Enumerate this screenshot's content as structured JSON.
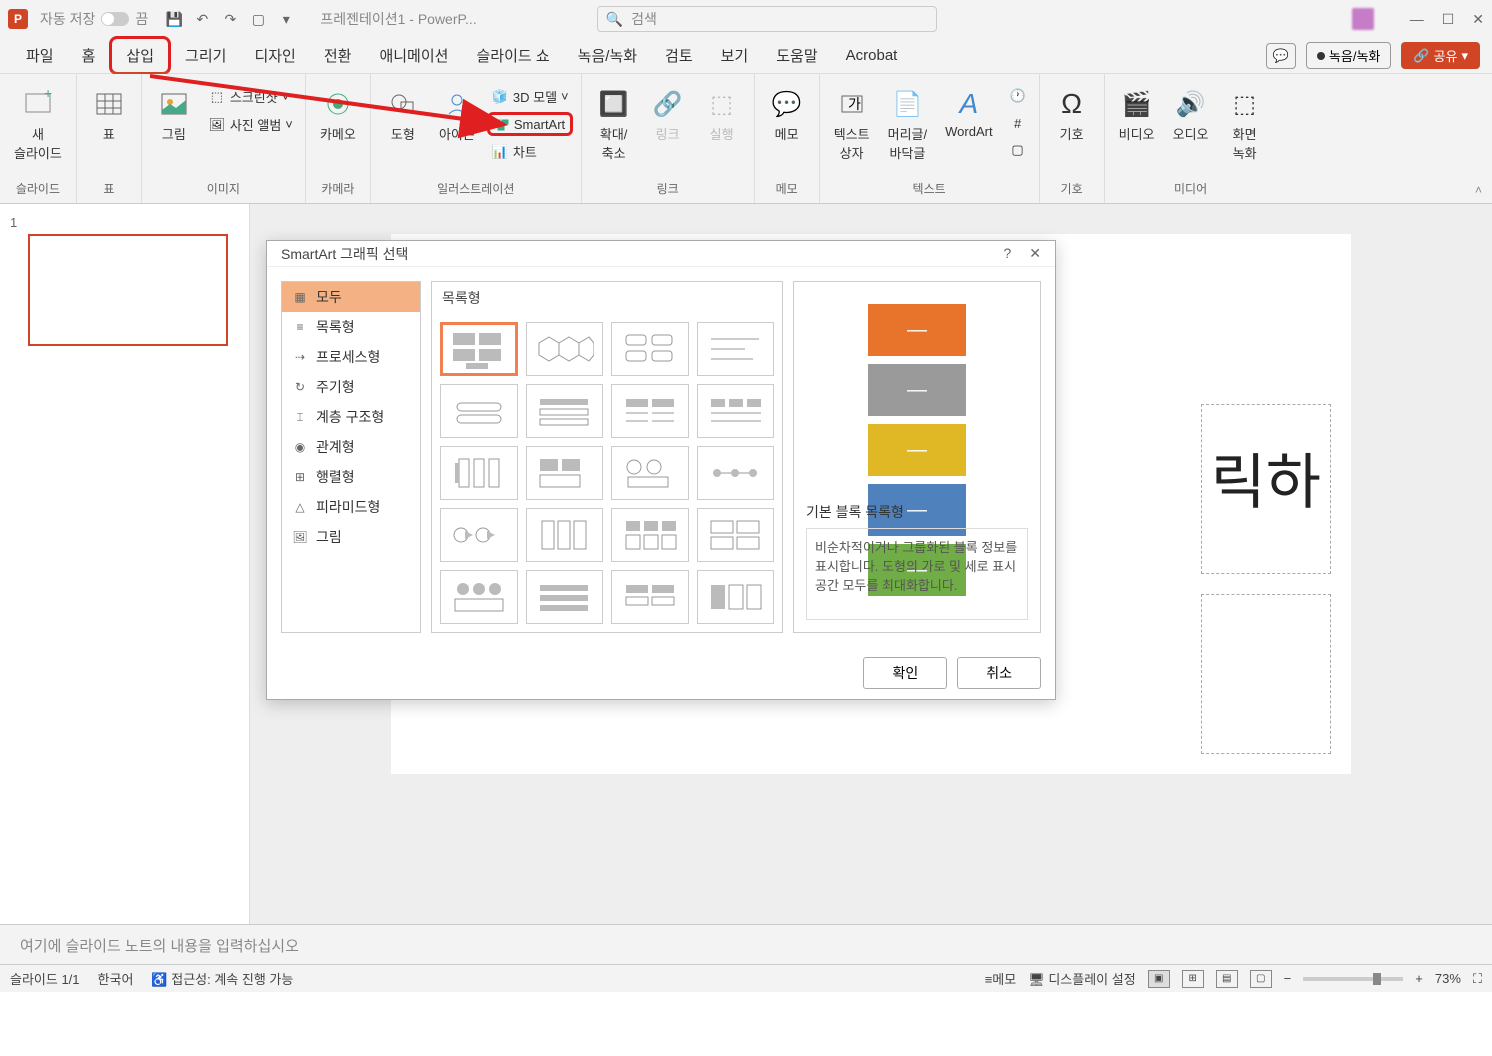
{
  "app": {
    "letter": "P",
    "autosave_label": "자동 저장",
    "autosave_state": "끔",
    "doc_title": "프레젠테이션1 - PowerP...",
    "search_placeholder": "검색"
  },
  "tabs": {
    "file": "파일",
    "home": "홈",
    "insert": "삽입",
    "draw": "그리기",
    "design": "디자인",
    "transition": "전환",
    "animation": "애니메이션",
    "slideshow": "슬라이드 쇼",
    "record": "녹음/녹화",
    "review": "검토",
    "view": "보기",
    "help": "도움말",
    "acrobat": "Acrobat"
  },
  "ribbon_right": {
    "rec": "녹음/녹화",
    "share": "공유"
  },
  "ribbon": {
    "slides": {
      "new_slide": "새\n슬라이드",
      "group": "슬라이드"
    },
    "tables": {
      "table": "표",
      "group": "표"
    },
    "images": {
      "picture": "그림",
      "screenshot": "스크린샷",
      "album": "사진 앨범",
      "group": "이미지"
    },
    "camera": {
      "cameo": "카메오",
      "group": "카메라"
    },
    "illust": {
      "shapes": "도형",
      "icons": "아이콘",
      "model3d": "3D 모델",
      "smartart": "SmartArt",
      "chart": "차트",
      "group": "일러스트레이션"
    },
    "links": {
      "zoom": "확대/\n축소",
      "link": "링크",
      "action": "실행",
      "group": "링크"
    },
    "memo": {
      "memo": "메모",
      "group": "메모"
    },
    "text": {
      "textbox": "텍스트\n상자",
      "headerfooter": "머리글/\n바닥글",
      "wordart": "WordArt",
      "group": "텍스트"
    },
    "symbols": {
      "symbol": "기호",
      "group": "기호"
    },
    "media": {
      "video": "비디오",
      "audio": "오디오",
      "screenrec": "화면\n녹화",
      "group": "미디어"
    }
  },
  "thumb": {
    "num": "1"
  },
  "slide": {
    "placeholder": "릭하"
  },
  "notes": {
    "placeholder": "여기에 슬라이드 노트의 내용을 입력하십시오"
  },
  "status": {
    "slide": "슬라이드 1/1",
    "lang": "한국어",
    "access": "접근성: 계속 진행 가능",
    "memo": "메모",
    "display": "디스플레이 설정",
    "zoom": "73%"
  },
  "dialog": {
    "title": "SmartArt 그래픽 선택",
    "cats": {
      "all": "모두",
      "list": "목록형",
      "process": "프로세스형",
      "cycle": "주기형",
      "hierarchy": "계층 구조형",
      "relation": "관계형",
      "matrix": "행렬형",
      "pyramid": "피라미드형",
      "picture": "그림"
    },
    "gallery_header": "목록형",
    "preview_title": "기본 블록 목록형",
    "preview_desc": "비순차적이거나 그룹화된 블록 정보를 표시합니다. 도형의 가로 및 세로 표시 공간 모두를 최대화합니다.",
    "ok": "확인",
    "cancel": "취소",
    "colors": {
      "orange": "#e8742c",
      "gray": "#9a9a9a",
      "yellow": "#e0b826",
      "blue": "#4f81bd",
      "green": "#70ad47"
    }
  }
}
